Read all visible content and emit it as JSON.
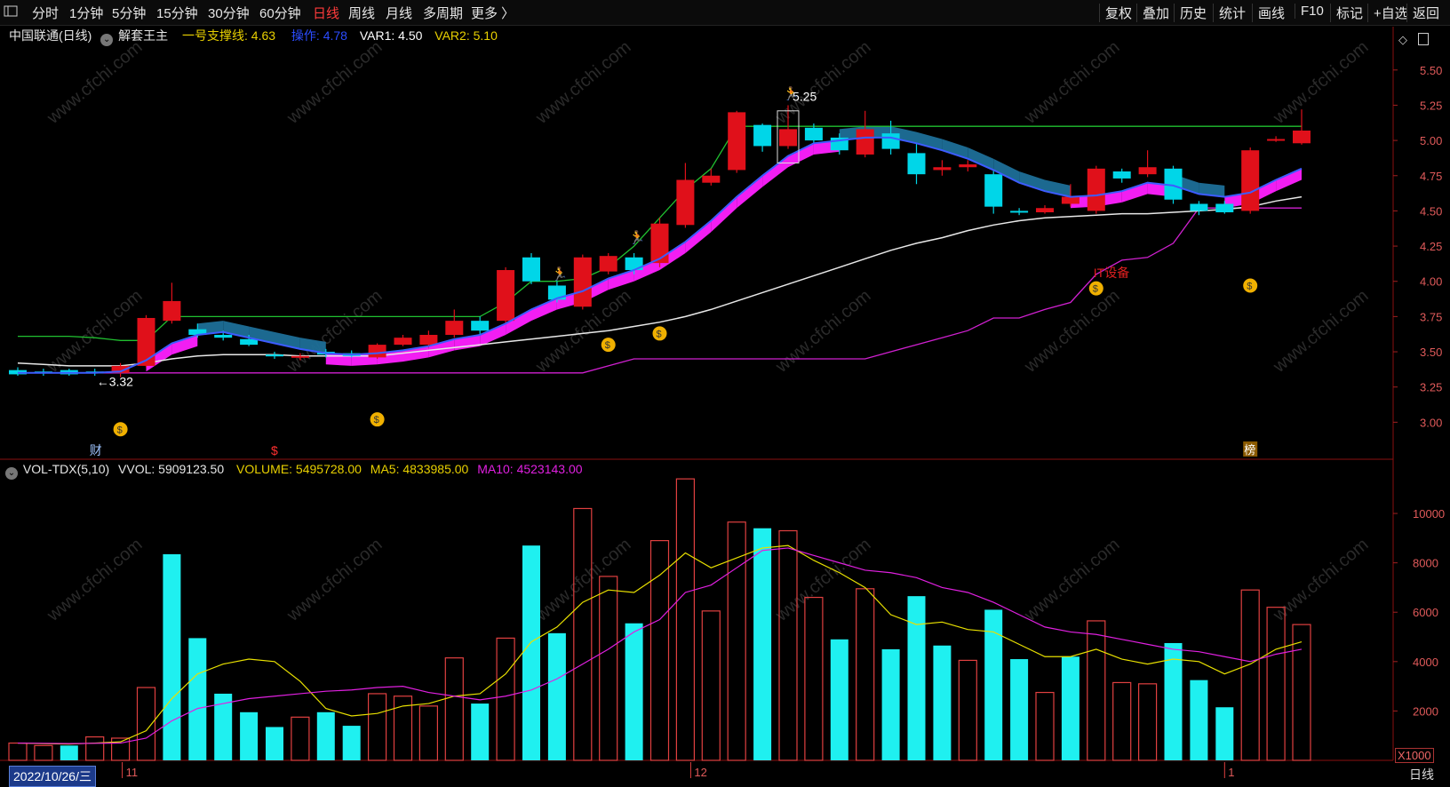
{
  "toolbar": {
    "left_icon": "window-icon",
    "periods": [
      "分时",
      "1分钟",
      "5分钟",
      "15分钟",
      "30分钟",
      "60分钟",
      "日线",
      "周线",
      "月线",
      "多周期",
      "更多 〉"
    ],
    "active_period": "日线",
    "right_items": [
      "复权",
      "叠加",
      "历史",
      "统计",
      "画线",
      "F10",
      "标记",
      "+自选",
      "返回"
    ]
  },
  "header": {
    "stock": "中国联通(日线)",
    "indicator": "解套王主",
    "support_label": "一号支撑线: 4.63",
    "operate_label": "操作: 4.78",
    "var1_label": "VAR1: 4.50",
    "var2_label": "VAR2: 5.10"
  },
  "volume_header": {
    "name": "VOL-TDX(5,10)",
    "vvol": "VVOL: 5909123.50",
    "volume": "VOLUME: 5495728.00",
    "ma5": "MA5: 4833985.00",
    "ma10": "MA10: 4523143.00"
  },
  "annotations": {
    "high_label": "5.25",
    "low_label": "←3.32",
    "sector_tag": "IT设备",
    "cai_tag": "财",
    "bang_tag": "榜",
    "dollar_tag": "$"
  },
  "footer": {
    "date": "2022/10/26/三",
    "period": "日线",
    "scale": "X1000",
    "month_labels": [
      "11",
      "12",
      "1"
    ]
  },
  "watermark": "www.cfchi.com",
  "colors": {
    "up": "#e0101a",
    "down": "#00d6e8",
    "ma5": "#3c5cff",
    "ma_white": "#e8e8e8",
    "support": "#d020d0",
    "band": "#ff20ff",
    "band_dark": "#1d6f98",
    "resist": "#20c030",
    "axis": "#e05a5a",
    "vol_ma5": "#e8e000",
    "vol_ma10": "#e020e0"
  },
  "chart_data": {
    "type": "candlestick",
    "price_axis": {
      "ticks": [
        3.0,
        3.25,
        3.5,
        3.75,
        4.0,
        4.25,
        4.5,
        4.75,
        5.0,
        5.25,
        5.5
      ],
      "ylim": [
        2.75,
        5.65
      ]
    },
    "volume_axis": {
      "ticks": [
        2000,
        4000,
        6000,
        8000,
        10000
      ],
      "ylim": [
        0,
        11800
      ],
      "unit": "X1000"
    },
    "candles": [
      {
        "o": 3.37,
        "c": 3.34,
        "h": 3.39,
        "l": 3.33
      },
      {
        "o": 3.36,
        "c": 3.35,
        "h": 3.38,
        "l": 3.33
      },
      {
        "o": 3.37,
        "c": 3.34,
        "h": 3.38,
        "l": 3.33
      },
      {
        "o": 3.36,
        "c": 3.35,
        "h": 3.38,
        "l": 3.33
      },
      {
        "o": 3.35,
        "c": 3.4,
        "h": 3.42,
        "l": 3.32
      },
      {
        "o": 3.4,
        "c": 3.74,
        "h": 3.76,
        "l": 3.39
      },
      {
        "o": 3.72,
        "c": 3.86,
        "h": 3.99,
        "l": 3.7
      },
      {
        "o": 3.66,
        "c": 3.62,
        "h": 3.7,
        "l": 3.6
      },
      {
        "o": 3.62,
        "c": 3.6,
        "h": 3.65,
        "l": 3.58
      },
      {
        "o": 3.59,
        "c": 3.55,
        "h": 3.62,
        "l": 3.54
      },
      {
        "o": 3.48,
        "c": 3.47,
        "h": 3.5,
        "l": 3.45
      },
      {
        "o": 3.46,
        "c": 3.47,
        "h": 3.49,
        "l": 3.44
      },
      {
        "o": 3.5,
        "c": 3.48,
        "h": 3.52,
        "l": 3.46
      },
      {
        "o": 3.49,
        "c": 3.47,
        "h": 3.51,
        "l": 3.46
      },
      {
        "o": 3.46,
        "c": 3.55,
        "h": 3.56,
        "l": 3.45
      },
      {
        "o": 3.55,
        "c": 3.6,
        "h": 3.62,
        "l": 3.54
      },
      {
        "o": 3.55,
        "c": 3.62,
        "h": 3.65,
        "l": 3.53
      },
      {
        "o": 3.62,
        "c": 3.72,
        "h": 3.8,
        "l": 3.6
      },
      {
        "o": 3.72,
        "c": 3.65,
        "h": 3.75,
        "l": 3.62
      },
      {
        "o": 3.72,
        "c": 4.08,
        "h": 4.1,
        "l": 3.7
      },
      {
        "o": 4.17,
        "c": 4.0,
        "h": 4.2,
        "l": 3.98
      },
      {
        "o": 3.97,
        "c": 3.87,
        "h": 4.0,
        "l": 3.85
      },
      {
        "o": 3.82,
        "c": 4.17,
        "h": 4.19,
        "l": 3.8
      },
      {
        "o": 4.07,
        "c": 4.18,
        "h": 4.2,
        "l": 4.05
      },
      {
        "o": 4.17,
        "c": 4.08,
        "h": 4.2,
        "l": 4.05
      },
      {
        "o": 4.13,
        "c": 4.41,
        "h": 4.45,
        "l": 4.1
      },
      {
        "o": 4.4,
        "c": 4.72,
        "h": 4.84,
        "l": 4.38
      },
      {
        "o": 4.7,
        "c": 4.75,
        "h": 4.8,
        "l": 4.68
      },
      {
        "o": 4.79,
        "c": 5.2,
        "h": 5.21,
        "l": 4.77
      },
      {
        "o": 5.11,
        "c": 4.96,
        "h": 5.12,
        "l": 4.92
      },
      {
        "o": 4.96,
        "c": 5.08,
        "h": 5.25,
        "l": 4.94
      },
      {
        "o": 5.09,
        "c": 5.0,
        "h": 5.12,
        "l": 4.98
      },
      {
        "o": 5.02,
        "c": 4.93,
        "h": 5.05,
        "l": 4.9
      },
      {
        "o": 4.9,
        "c": 5.08,
        "h": 5.21,
        "l": 4.88
      },
      {
        "o": 5.05,
        "c": 4.94,
        "h": 5.14,
        "l": 4.9
      },
      {
        "o": 4.91,
        "c": 4.76,
        "h": 4.98,
        "l": 4.69
      },
      {
        "o": 4.79,
        "c": 4.81,
        "h": 4.86,
        "l": 4.75
      },
      {
        "o": 4.81,
        "c": 4.83,
        "h": 4.86,
        "l": 4.78
      },
      {
        "o": 4.76,
        "c": 4.53,
        "h": 4.79,
        "l": 4.48
      },
      {
        "o": 4.5,
        "c": 4.49,
        "h": 4.52,
        "l": 4.47
      },
      {
        "o": 4.49,
        "c": 4.52,
        "h": 4.54,
        "l": 4.48
      },
      {
        "o": 4.55,
        "c": 4.6,
        "h": 4.69,
        "l": 4.53
      },
      {
        "o": 4.5,
        "c": 4.8,
        "h": 4.82,
        "l": 4.48
      },
      {
        "o": 4.78,
        "c": 4.73,
        "h": 4.8,
        "l": 4.7
      },
      {
        "o": 4.76,
        "c": 4.81,
        "h": 4.93,
        "l": 4.74
      },
      {
        "o": 4.8,
        "c": 4.58,
        "h": 4.82,
        "l": 4.55
      },
      {
        "o": 4.55,
        "c": 4.5,
        "h": 4.57,
        "l": 4.47
      },
      {
        "o": 4.55,
        "c": 4.49,
        "h": 4.57,
        "l": 4.48
      },
      {
        "o": 4.5,
        "c": 4.93,
        "h": 4.95,
        "l": 4.48
      },
      {
        "o": 5.0,
        "c": 5.01,
        "h": 5.03,
        "l": 4.99
      },
      {
        "o": 4.98,
        "c": 5.07,
        "h": 5.22,
        "l": 4.97
      }
    ],
    "volume": [
      {
        "v": 700,
        "up": true
      },
      {
        "v": 600,
        "up": true
      },
      {
        "v": 600,
        "up": false
      },
      {
        "v": 950,
        "up": true
      },
      {
        "v": 900,
        "up": true
      },
      {
        "v": 2950,
        "up": true
      },
      {
        "v": 8350,
        "up": false
      },
      {
        "v": 4950,
        "up": false
      },
      {
        "v": 2700,
        "up": false
      },
      {
        "v": 1950,
        "up": false
      },
      {
        "v": 1350,
        "up": false
      },
      {
        "v": 1750,
        "up": true
      },
      {
        "v": 1950,
        "up": false
      },
      {
        "v": 1400,
        "up": false
      },
      {
        "v": 2700,
        "up": true
      },
      {
        "v": 2600,
        "up": true
      },
      {
        "v": 2200,
        "up": true
      },
      {
        "v": 4150,
        "up": true
      },
      {
        "v": 2300,
        "up": false
      },
      {
        "v": 4950,
        "up": true
      },
      {
        "v": 8700,
        "up": false
      },
      {
        "v": 5150,
        "up": false
      },
      {
        "v": 10200,
        "up": true
      },
      {
        "v": 7450,
        "up": true
      },
      {
        "v": 5550,
        "up": false
      },
      {
        "v": 8900,
        "up": true
      },
      {
        "v": 11400,
        "up": true
      },
      {
        "v": 6050,
        "up": true
      },
      {
        "v": 9650,
        "up": true
      },
      {
        "v": 9400,
        "up": false
      },
      {
        "v": 9300,
        "up": true
      },
      {
        "v": 6600,
        "up": true
      },
      {
        "v": 4900,
        "up": false
      },
      {
        "v": 6950,
        "up": true
      },
      {
        "v": 4500,
        "up": false
      },
      {
        "v": 6650,
        "up": false
      },
      {
        "v": 4650,
        "up": false
      },
      {
        "v": 4050,
        "up": true
      },
      {
        "v": 6100,
        "up": false
      },
      {
        "v": 4100,
        "up": false
      },
      {
        "v": 2750,
        "up": true
      },
      {
        "v": 4200,
        "up": false
      },
      {
        "v": 5650,
        "up": true
      },
      {
        "v": 3150,
        "up": true
      },
      {
        "v": 3100,
        "up": true
      },
      {
        "v": 4750,
        "up": false
      },
      {
        "v": 3250,
        "up": false
      },
      {
        "v": 2150,
        "up": false
      },
      {
        "v": 6900,
        "up": true
      },
      {
        "v": 6200,
        "up": true
      },
      {
        "v": 5500,
        "up": true
      }
    ],
    "ma_white": [
      3.42,
      3.41,
      3.4,
      3.4,
      3.4,
      3.42,
      3.45,
      3.47,
      3.48,
      3.48,
      3.48,
      3.47,
      3.47,
      3.47,
      3.47,
      3.49,
      3.51,
      3.53,
      3.55,
      3.57,
      3.59,
      3.61,
      3.63,
      3.65,
      3.68,
      3.71,
      3.75,
      3.8,
      3.86,
      3.92,
      3.98,
      4.04,
      4.1,
      4.16,
      4.22,
      4.27,
      4.31,
      4.36,
      4.4,
      4.43,
      4.45,
      4.46,
      4.47,
      4.48,
      4.48,
      4.49,
      4.5,
      4.51,
      4.53,
      4.57,
      4.6
    ],
    "ma_blue": [
      3.35,
      3.35,
      3.35,
      3.35,
      3.36,
      3.44,
      3.56,
      3.62,
      3.64,
      3.6,
      3.56,
      3.52,
      3.49,
      3.48,
      3.49,
      3.51,
      3.54,
      3.59,
      3.62,
      3.7,
      3.8,
      3.88,
      3.93,
      4.02,
      4.08,
      4.16,
      4.28,
      4.43,
      4.6,
      4.75,
      4.89,
      4.98,
      5.0,
      5.02,
      5.02,
      4.98,
      4.93,
      4.87,
      4.79,
      4.7,
      4.64,
      4.6,
      4.61,
      4.64,
      4.7,
      4.68,
      4.62,
      4.6,
      4.63,
      4.72,
      4.8
    ],
    "support_purple": [
      3.35,
      3.35,
      3.35,
      3.35,
      3.35,
      3.35,
      3.35,
      3.35,
      3.35,
      3.35,
      3.35,
      3.35,
      3.35,
      3.35,
      3.35,
      3.35,
      3.35,
      3.35,
      3.35,
      3.35,
      3.35,
      3.35,
      3.35,
      3.4,
      3.45,
      3.45,
      3.45,
      3.45,
      3.45,
      3.45,
      3.45,
      3.45,
      3.45,
      3.45,
      3.5,
      3.55,
      3.6,
      3.65,
      3.74,
      3.74,
      3.8,
      3.85,
      4.05,
      4.15,
      4.17,
      4.27,
      4.52,
      4.52,
      4.52,
      4.52,
      4.52
    ],
    "resist_green": [
      3.61,
      3.61,
      3.61,
      3.6,
      3.58,
      3.58,
      3.75,
      3.75,
      3.75,
      3.75,
      3.75,
      3.75,
      3.75,
      3.75,
      3.75,
      3.75,
      3.75,
      3.75,
      3.75,
      3.85,
      4.0,
      4.0,
      4.02,
      4.1,
      4.25,
      4.45,
      4.65,
      4.8,
      5.1,
      5.1,
      5.1,
      5.1,
      5.1,
      5.1,
      5.1,
      5.1,
      5.1,
      5.1,
      5.1,
      5.1,
      5.1,
      5.1,
      5.1,
      5.1,
      5.1,
      5.1,
      5.1,
      5.1,
      5.1,
      5.1,
      5.1
    ],
    "vol_ma5": [
      700,
      680,
      660,
      700,
      750,
      1200,
      2500,
      3500,
      3900,
      4100,
      4000,
      3200,
      2100,
      1800,
      1900,
      2200,
      2300,
      2600,
      2700,
      3500,
      4800,
      5400,
      6400,
      6900,
      6800,
      7500,
      8400,
      7800,
      8200,
      8600,
      8700,
      8100,
      7600,
      7000,
      5900,
      5500,
      5600,
      5300,
      5200,
      4700,
      4200,
      4200,
      4500,
      4100,
      3900,
      4100,
      4000,
      3500,
      3900,
      4500,
      4800
    ],
    "vol_ma10": [
      700,
      690,
      680,
      690,
      700,
      900,
      1600,
      2100,
      2300,
      2500,
      2600,
      2700,
      2800,
      2850,
      2950,
      3000,
      2750,
      2600,
      2450,
      2600,
      2850,
      3300,
      3900,
      4500,
      5200,
      5700,
      6800,
      7100,
      7800,
      8500,
      8600,
      8300,
      8000,
      7700,
      7600,
      7400,
      7000,
      6800,
      6400,
      5900,
      5400,
      5200,
      5100,
      4900,
      4700,
      4500,
      4400,
      4200,
      4000,
      4300,
      4500
    ]
  }
}
